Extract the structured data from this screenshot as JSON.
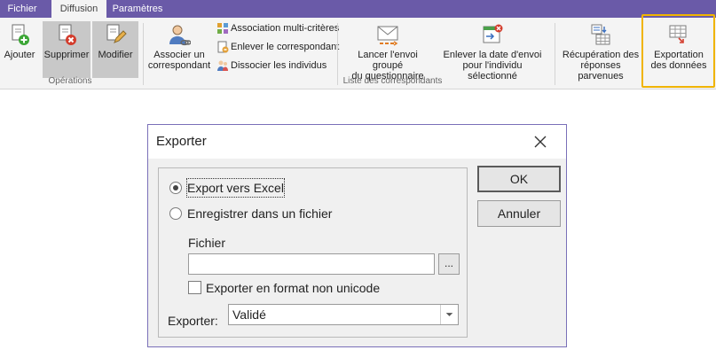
{
  "tabs": [
    {
      "label": "Fichier",
      "active": false
    },
    {
      "label": "Diffusion",
      "active": true
    },
    {
      "label": "Paramètres",
      "active": false
    }
  ],
  "ribbon": {
    "operations": {
      "label": "Opérations",
      "ajouter": "Ajouter",
      "supprimer": "Supprimer",
      "modifier": "Modifier"
    },
    "correspondants": {
      "label": "Liste des correspondants",
      "associer_line1": "Associer un",
      "associer_line2": "correspondant",
      "association_multi": "Association multi-critères",
      "enlever_correspondant": "Enlever le correspondant",
      "dissocier": "Dissocier les individus",
      "lancer_line1": "Lancer l'envoi groupé",
      "lancer_line2": "du questionnaire",
      "enlever_date_line1": "Enlever la date d'envoi",
      "enlever_date_line2": "pour l'individu sélectionné",
      "recuperation_line1": "Récupération des",
      "recuperation_line2": "réponses parvenues"
    },
    "exportation_line1": "Exportation",
    "exportation_line2": "des données",
    "highlight_color": "#f0b400",
    "accent_color": "#6a5aa8"
  },
  "dialog": {
    "title": "Exporter",
    "radio_excel": "Export vers Excel",
    "radio_fichier": "Enregistrer dans un fichier",
    "selected_radio": "excel",
    "fichier_label": "Fichier",
    "fichier_value": "",
    "browse_label": "...",
    "checkbox_label": "Exporter en format non unicode",
    "checkbox_checked": false,
    "exporter_label": "Exporter:",
    "exporter_value": "Validé",
    "ok_label": "OK",
    "cancel_label": "Annuler"
  }
}
